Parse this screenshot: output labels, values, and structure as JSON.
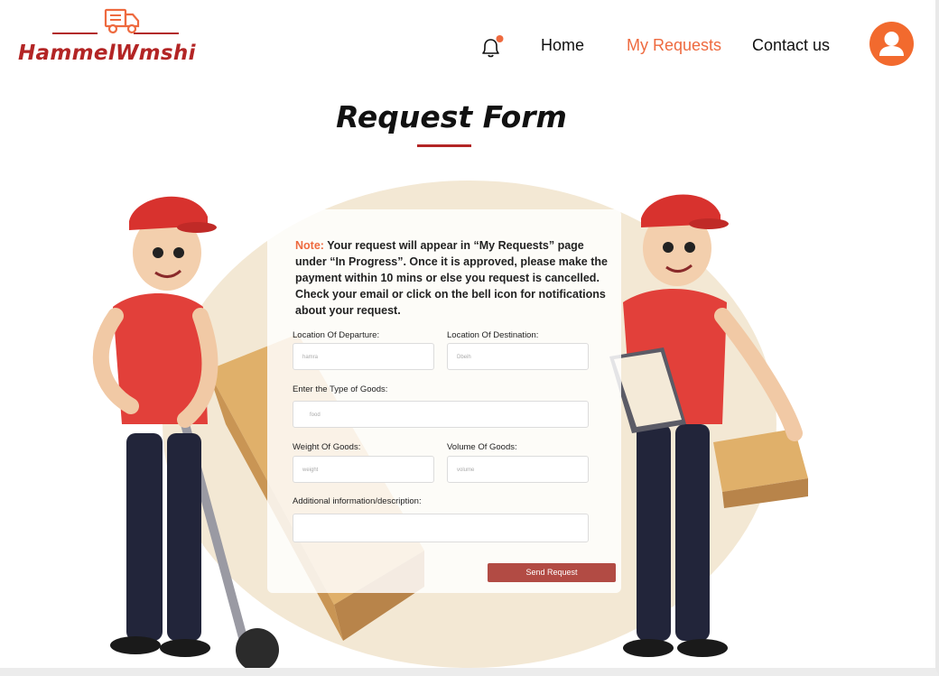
{
  "brand": {
    "name": "HammelWmshi",
    "color": "#b32525"
  },
  "nav": {
    "home": "Home",
    "my_requests": "My Requests",
    "contact": "Contact us",
    "active_color": "#ee6a3f"
  },
  "icons": {
    "bell": "bell-icon",
    "avatar": "user-avatar-icon",
    "truck": "truck-icon"
  },
  "page": {
    "title": "Request Form"
  },
  "form": {
    "note_label": "Note:",
    "note_text": " Your request will appear in “My Requests” page under “In Progress”. Once it is approved, please make the payment within 10 mins or else you request is cancelled. Check your email or click on the bell icon for notifications about your request.",
    "departure_label": "Location Of Departure:",
    "departure_placeholder": "hamra",
    "destination_label": "Location  Of Destination:",
    "destination_placeholder": "Dbeih",
    "goods_type_label": "Enter the Type of Goods:",
    "goods_type_placeholder": "food",
    "weight_label": "Weight Of Goods:",
    "weight_placeholder": "weight",
    "volume_label": "Volume Of Goods:",
    "volume_placeholder": "volume",
    "info_label": "Additional information/description:",
    "info_placeholder": "",
    "submit_label": "Send Request"
  }
}
